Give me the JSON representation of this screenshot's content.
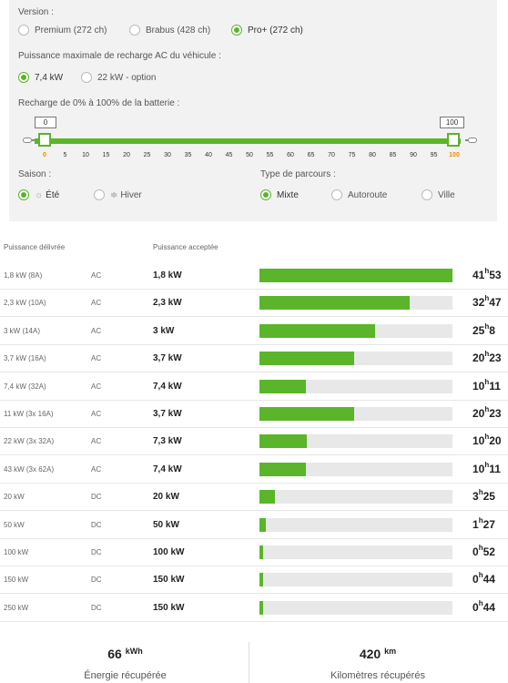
{
  "version": {
    "label": "Version :",
    "options": [
      "Premium (272 ch)",
      "Brabus (428 ch)",
      "Pro+ (272 ch)"
    ],
    "selected_index": 2
  },
  "power_ac": {
    "label": "Puissance maximale de recharge AC du véhicule :",
    "options": [
      "7,4 kW",
      "22 kW - option"
    ],
    "selected_index": 0
  },
  "battery": {
    "label": "Recharge de 0% à 100% de la batterie :",
    "start_value": "0",
    "end_value": "100",
    "ticks": [
      "0",
      "5",
      "10",
      "15",
      "20",
      "25",
      "30",
      "35",
      "40",
      "45",
      "50",
      "55",
      "60",
      "65",
      "70",
      "75",
      "80",
      "85",
      "90",
      "95",
      "100"
    ]
  },
  "season": {
    "label": "Saison :",
    "options": [
      "Été",
      "Hiver"
    ],
    "icons": [
      "sun-icon",
      "snowflake-icon"
    ],
    "selected_index": 0
  },
  "route": {
    "label": "Type de parcours :",
    "options": [
      "Mixte",
      "Autoroute",
      "Ville"
    ],
    "selected_index": 0
  },
  "table": {
    "headers": [
      "Puissance délivrée",
      "Puissance acceptée"
    ],
    "rows": [
      {
        "delivered": "1,8 kW (8A)",
        "type": "AC",
        "accepted": "1,8 kW",
        "fill": 1.0,
        "h": "41",
        "m": "53"
      },
      {
        "delivered": "2,3 kW (10A)",
        "type": "AC",
        "accepted": "2,3 kW",
        "fill": 0.78,
        "h": "32",
        "m": "47"
      },
      {
        "delivered": "3 kW (14A)",
        "type": "AC",
        "accepted": "3 kW",
        "fill": 0.6,
        "h": "25",
        "m": "8"
      },
      {
        "delivered": "3,7 kW (16A)",
        "type": "AC",
        "accepted": "3,7 kW",
        "fill": 0.49,
        "h": "20",
        "m": "23"
      },
      {
        "delivered": "7,4 kW (32A)",
        "type": "AC",
        "accepted": "7,4 kW",
        "fill": 0.24,
        "h": "10",
        "m": "11"
      },
      {
        "delivered": "11 kW (3x 16A)",
        "type": "AC",
        "accepted": "3,7 kW",
        "fill": 0.49,
        "h": "20",
        "m": "23"
      },
      {
        "delivered": "22 kW (3x 32A)",
        "type": "AC",
        "accepted": "7,3 kW",
        "fill": 0.245,
        "h": "10",
        "m": "20"
      },
      {
        "delivered": "43 kW (3x 62A)",
        "type": "AC",
        "accepted": "7,4 kW",
        "fill": 0.24,
        "h": "10",
        "m": "11"
      },
      {
        "delivered": "20 kW",
        "type": "DC",
        "accepted": "20 kW",
        "fill": 0.08,
        "h": "3",
        "m": "25"
      },
      {
        "delivered": "50 kW",
        "type": "DC",
        "accepted": "50 kW",
        "fill": 0.035,
        "h": "1",
        "m": "27"
      },
      {
        "delivered": "100 kW",
        "type": "DC",
        "accepted": "100 kW",
        "fill": 0.02,
        "h": "0",
        "m": "52"
      },
      {
        "delivered": "150 kW",
        "type": "DC",
        "accepted": "150 kW",
        "fill": 0.018,
        "h": "0",
        "m": "44"
      },
      {
        "delivered": "250 kW",
        "type": "DC",
        "accepted": "150 kW",
        "fill": 0.018,
        "h": "0",
        "m": "44"
      }
    ]
  },
  "totals": {
    "energy_value": "66",
    "energy_unit": "kWh",
    "energy_label": "Énergie récupérée",
    "km_value": "420",
    "km_unit": "km",
    "km_label": "Kilomètres récupérés"
  },
  "colors": {
    "accent": "#5ab52a",
    "highlight_tick": "#f08c00",
    "bar_bg": "#e8e8e8"
  }
}
